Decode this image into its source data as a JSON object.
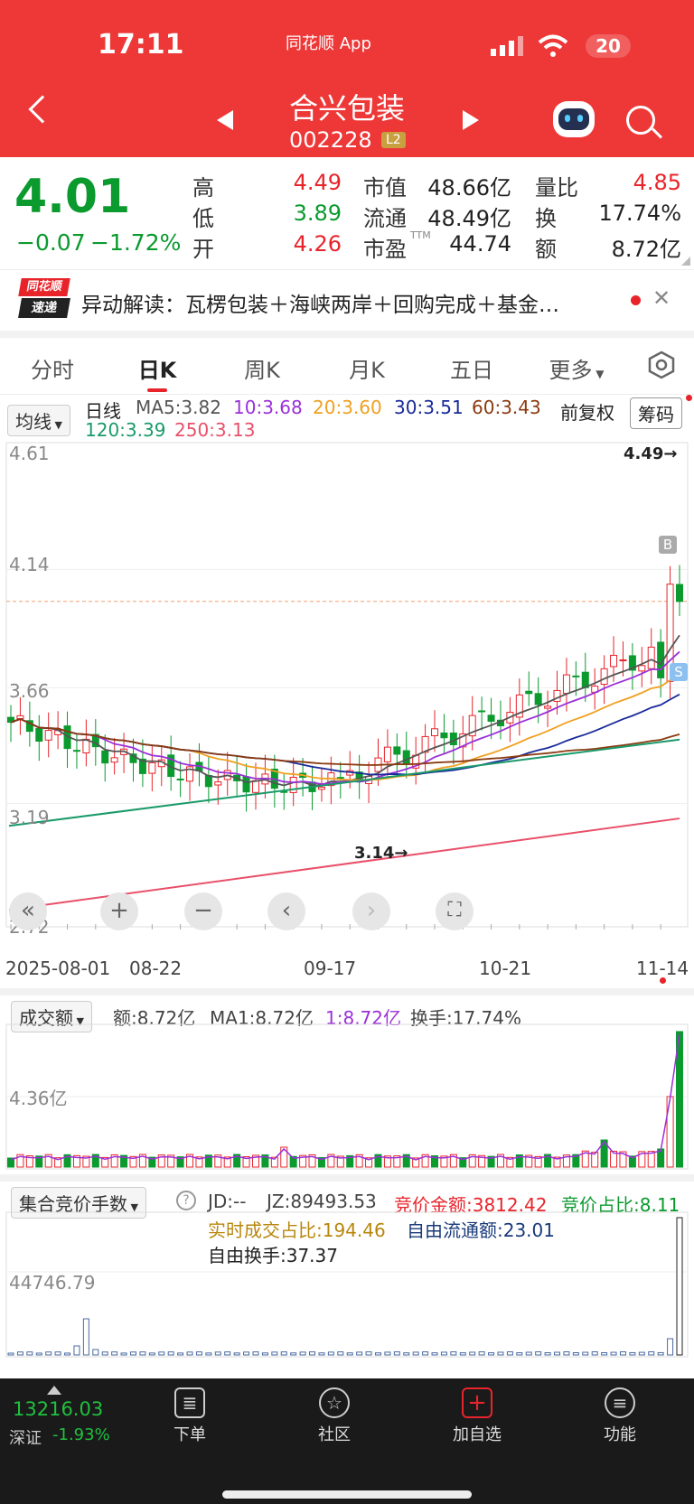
{
  "status": {
    "time": "17:11",
    "app_label": "同花顺 App",
    "battery": "20"
  },
  "stock": {
    "name": "合兴包装",
    "code": "002228",
    "level": "L2"
  },
  "quote": {
    "price": "4.01",
    "change": "−0.07",
    "change_pct": "−1.72%",
    "high_label": "高",
    "high": "4.49",
    "low_label": "低",
    "low": "3.89",
    "open_label": "开",
    "open": "4.26",
    "mcap_label": "市值",
    "mcap": "48.66亿",
    "float_label": "流通",
    "float": "48.49亿",
    "pe_label": "市盈",
    "pe_sup": "TTM",
    "pe": "44.74",
    "vr_label": "量比",
    "vr": "4.85",
    "turn_label": "换",
    "turn": "17.74%",
    "amt_label": "额",
    "amt": "8.72亿"
  },
  "news": {
    "brand_top": "同花顺",
    "brand_bottom": "速递",
    "text": "异动解读：瓦楞包装＋海峡两岸＋回购完成＋基金…"
  },
  "tabs": [
    "分时",
    "日K",
    "周K",
    "月K",
    "五日",
    "更多"
  ],
  "ma": {
    "selector": "均线",
    "label": "日线",
    "ma5": "MA5:3.82",
    "ma10": "10:3.68",
    "ma20": "20:3.60",
    "ma30": "30:3.51",
    "ma60": "60:3.43",
    "ma120": "120:3.39",
    "ma250": "250:3.13",
    "adjust": "前复权",
    "chips": "筹码"
  },
  "kline": {
    "y_labels": [
      "4.61",
      "4.14",
      "3.66",
      "3.19",
      "2.72"
    ],
    "high_mark": "4.49→",
    "low_mark": "3.14→",
    "buy": "B",
    "sell": "S",
    "dates": [
      "2025-08-01",
      "08-22",
      "09-17",
      "10-21",
      "11-14"
    ]
  },
  "volume": {
    "selector": "成交额",
    "amt": "额:8.72亿",
    "ma1": "MA1:8.72亿",
    "one": "1:8.72亿",
    "turnover": "换手:17.74%",
    "y_label": "4.36亿"
  },
  "auction": {
    "selector": "集合竞价手数",
    "help": "?",
    "jd": "JD:--",
    "jz": "JZ:89493.53",
    "amount": "竞价金额:3812.42",
    "ratio": "竞价占比:8.11",
    "realtime": "实时成交占比:194.46",
    "free_float": "自由流通额:23.01",
    "free_turn": "自由换手:37.37",
    "y_label": "44746.79"
  },
  "index": {
    "value": "13216.03",
    "name": "深证",
    "pct": "-1.93%"
  },
  "nav": [
    "下单",
    "社区",
    "加自选",
    "功能"
  ],
  "colors": {
    "header": "#ee3838",
    "up": "#e8242b",
    "down": "#0a9a2e",
    "ma5": "#555555",
    "ma10": "#9b30d9",
    "ma20": "#f0a020",
    "ma30": "#1a2a9a",
    "ma60": "#8b3a10",
    "ma120": "#1a9a6a",
    "ma250": "#e8506a"
  }
}
